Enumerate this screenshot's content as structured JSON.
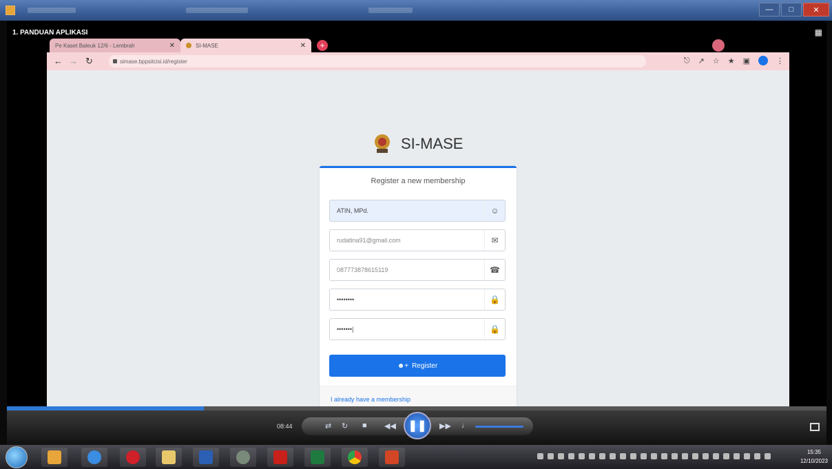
{
  "player": {
    "title": "1. PANDUAN APLIKASI",
    "time": "08:44"
  },
  "browser": {
    "tabs": [
      {
        "label": "Pe Kaset Baleuk 12/6 - Lembrah"
      },
      {
        "label": "SI-MASE"
      }
    ],
    "url": "simase.bppsitcisi.id/register"
  },
  "login": {
    "brand": "SI-MASE",
    "message": "Register a new membership",
    "fields": {
      "name": "ATIN, MPd.",
      "email": "rudatina91@gmail.com",
      "phone": "087773878615119",
      "password": "••••••••",
      "retype": "•••••••|"
    },
    "register_label": "Register",
    "member_link": "I already have a membership"
  },
  "seek_progress": 0.24,
  "taskbar": {
    "apps": [
      "ie",
      "opera",
      "explorer",
      "word",
      "media",
      "pdf",
      "excel",
      "chrome",
      "powerpoint"
    ],
    "clock_time": "15:35",
    "clock_date": "12/10/2023"
  },
  "colors": {
    "accent": "#1a73e8",
    "tab_pink": "#f6d4d8",
    "page_bg": "#e9ecef"
  }
}
